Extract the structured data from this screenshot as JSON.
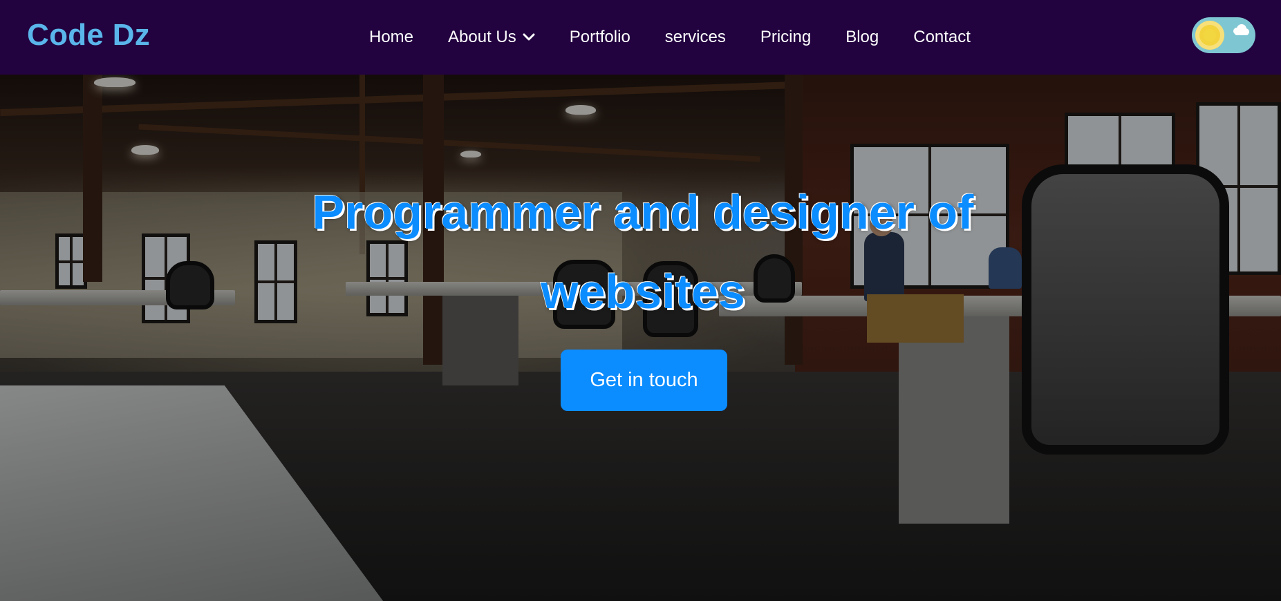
{
  "brand": {
    "logo_text": "Code Dz",
    "logo_color": "#5ab6ea",
    "nav_background": "#22023f"
  },
  "nav": {
    "items": [
      {
        "label": "Home"
      },
      {
        "label": "About Us",
        "has_dropdown": true,
        "icon": "chevron-down-icon"
      },
      {
        "label": "Portfolio"
      },
      {
        "label": "services"
      },
      {
        "label": "Pricing"
      },
      {
        "label": "Blog"
      },
      {
        "label": "Contact"
      }
    ]
  },
  "theme_toggle": {
    "state": "light",
    "knob_icon": "sun-icon",
    "track_icon": "cloud-icon",
    "track_color": "#7fc6d3",
    "knob_color": "#f2d33d"
  },
  "hero": {
    "title": "Programmer and designer of websites",
    "title_color": "#0b8cff",
    "cta_label": "Get in touch",
    "cta_color": "#0b8cff",
    "background_image": "office-interior-photo"
  }
}
